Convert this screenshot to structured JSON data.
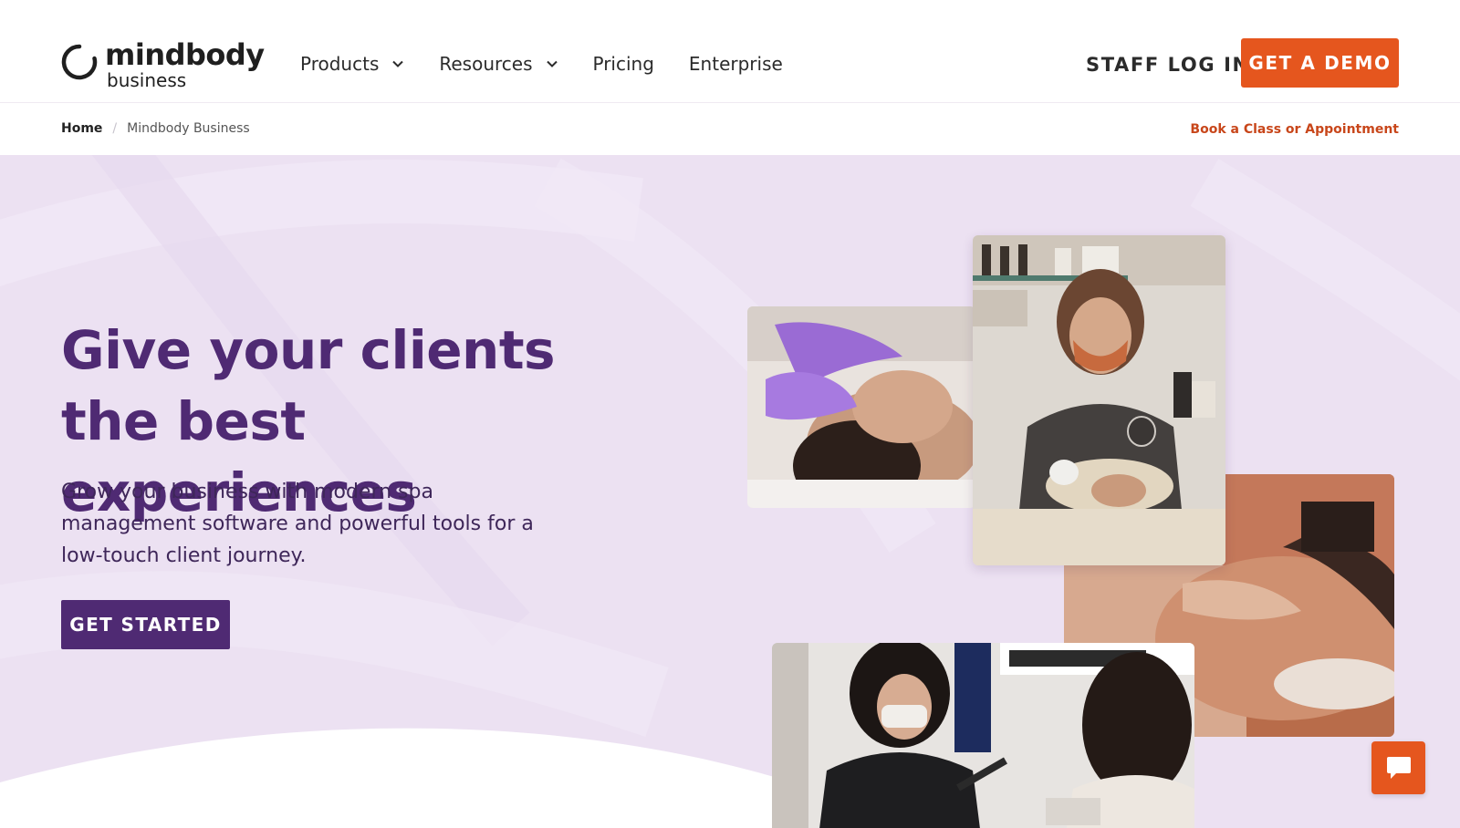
{
  "brand": {
    "wordmark": "mindbody",
    "sub": "business",
    "accent": "#e5561e",
    "purple": "#4f2a73"
  },
  "nav": {
    "items": [
      {
        "label": "Products",
        "has_dropdown": true
      },
      {
        "label": "Resources",
        "has_dropdown": true
      },
      {
        "label": "Pricing",
        "has_dropdown": false
      },
      {
        "label": "Enterprise",
        "has_dropdown": false
      }
    ],
    "staff_login": "STAFF LOG IN",
    "demo_button": "GET A DEMO"
  },
  "breadcrumb": {
    "home": "Home",
    "separator": "/",
    "current": "Mindbody Business"
  },
  "book_link": "Book a Class or Appointment",
  "hero": {
    "headline": "Give your clients the best experiences",
    "subcopy": "Grow your business with modern spa management software and powerful tools for a low-touch client journey.",
    "cta": "GET STARTED",
    "photos": [
      "facial-treatment-photo",
      "esthetician-masked-photo",
      "massage-photo",
      "nail-technician-photo"
    ]
  },
  "chat": {
    "icon": "chat-bubble-icon"
  }
}
